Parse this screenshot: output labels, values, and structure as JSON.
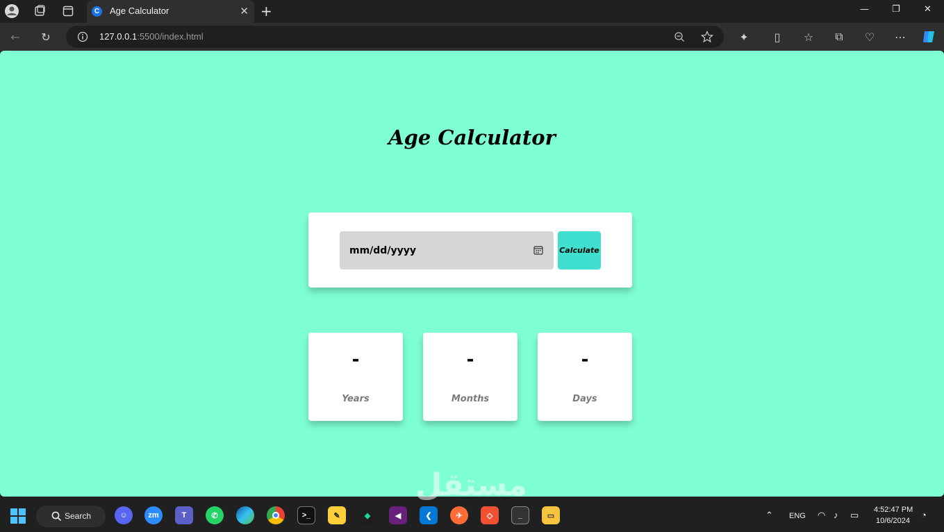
{
  "browser": {
    "tab_title": "Age Calculator",
    "tab_favicon": "C",
    "url_host": "127.0.0.1",
    "url_rest": ":5500/index.html"
  },
  "page": {
    "heading": "Age Calculator",
    "date_placeholder": "mm/dd/yyyy",
    "calculate_label": "Calculate",
    "results": [
      {
        "value": "-",
        "label": "Years"
      },
      {
        "value": "-",
        "label": "Months"
      },
      {
        "value": "-",
        "label": "Days"
      }
    ],
    "background_color": "#7fffd4",
    "button_color": "#40e0d0"
  },
  "watermark": "مستقل",
  "taskbar": {
    "search_label": "Search",
    "language": "ENG",
    "time": "4:52:47 PM",
    "date": "10/6/2024",
    "apps": [
      "discord-icon",
      "zoom-icon",
      "teams-icon",
      "whatsapp-icon",
      "edge-icon",
      "chrome-icon",
      "terminal-icon",
      "tool-icon",
      "pycharm-icon",
      "visual-studio-icon",
      "vscode-icon",
      "postman-icon",
      "git-icon",
      "terminal-preview-icon",
      "file-explorer-icon"
    ],
    "zoom_label": "zm"
  }
}
